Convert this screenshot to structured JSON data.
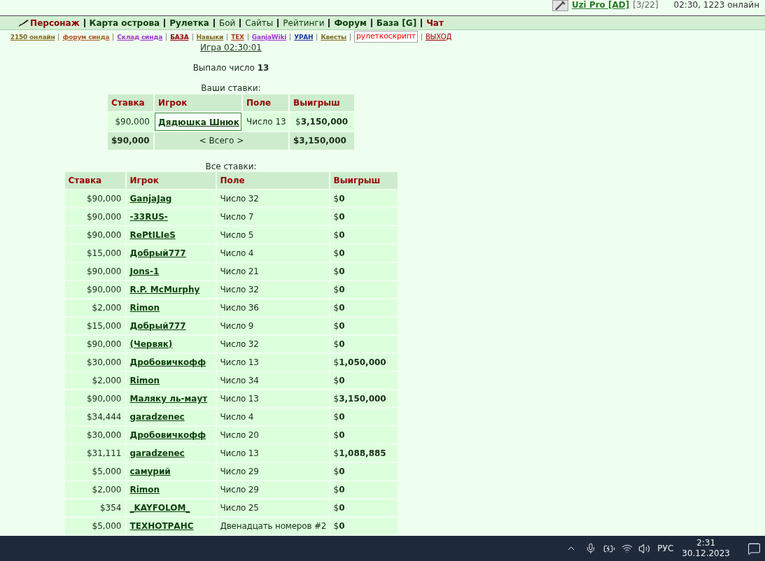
{
  "user_bar": {
    "name": "Uzi Pro [AD]",
    "rank": "[3/22]",
    "status": "02:30, 1223 онлайн"
  },
  "nav": [
    {
      "label": "Персонаж",
      "bold": true,
      "color": "#8b0000"
    },
    {
      "label": "Карта острова",
      "bold": true,
      "color": "#0b3d0b"
    },
    {
      "label": "Рулетка",
      "bold": true,
      "color": "#0b3d0b"
    },
    {
      "label": "Бой",
      "bold": false,
      "color": "#0b3d0b"
    },
    {
      "label": "Сайты",
      "bold": false,
      "color": "#0b3d0b"
    },
    {
      "label": "Рейтинги",
      "bold": false,
      "color": "#0b3d0b"
    },
    {
      "label": "Форум",
      "bold": true,
      "color": "#0b3d0b"
    },
    {
      "label": "База [G]",
      "bold": true,
      "color": "#0b3d0b"
    },
    {
      "label": "Чат",
      "bold": true,
      "color": "#8b0000"
    }
  ],
  "sub_links": [
    {
      "label": "2150 онлайн",
      "kind": "link",
      "color": "#7d6b1e"
    },
    {
      "label": "форум синда",
      "kind": "link",
      "color": "#b05a28"
    },
    {
      "label": "Склад синда",
      "kind": "link",
      "color": "#a030d0"
    },
    {
      "label": "БАЗА",
      "kind": "link",
      "color": "#8b0000"
    },
    {
      "label": "Навыки",
      "kind": "link",
      "color": "#7d6b1e"
    },
    {
      "label": "ТЕХ",
      "kind": "link",
      "color": "#b03a1a"
    },
    {
      "label": "GanjaWiki",
      "kind": "link",
      "color": "#a030d0"
    },
    {
      "label": "УРАН",
      "kind": "link",
      "color": "#1a3aa0"
    },
    {
      "label": "Квесты",
      "kind": "link",
      "color": "#7d6b1e"
    },
    {
      "label": "рулеткоскрипт",
      "kind": "boxed",
      "color": "#ff0000"
    },
    {
      "label": "ВЫХОД",
      "kind": "plain",
      "color": "#a00000"
    }
  ],
  "game_link": "Игра 02:30:01",
  "result": "Выпало число **13**",
  "my_bets": {
    "title": "Ваши ставки:",
    "columns": [
      "Ставка",
      "Игрок",
      "Поле",
      "Выигрыш"
    ],
    "rows": [
      {
        "bet": "$90,000",
        "player": "Дядюшка Шнюк",
        "field": "Число 13",
        "win": "$**3,150,000**",
        "highlighted": true
      }
    ],
    "total": {
      "bet": "$90,000",
      "label": "< Всего >",
      "win": "$3,150,000"
    }
  },
  "all_bets": {
    "title": "Все ставки:",
    "columns": [
      "Ставка",
      "Игрок",
      "Поле",
      "Выигрыш"
    ],
    "rows": [
      {
        "bet": "$90,000",
        "player": "GanjaJag",
        "field": "Число 32",
        "win": "$**0**"
      },
      {
        "bet": "$90,000",
        "player": "-33RUS-",
        "field": "Число 7",
        "win": "$**0**"
      },
      {
        "bet": "$90,000",
        "player": "RePtILIeS",
        "field": "Число 5",
        "win": "$**0**"
      },
      {
        "bet": "$15,000",
        "player": "Добрый777",
        "field": "Число 4",
        "win": "$**0**"
      },
      {
        "bet": "$90,000",
        "player": "Jons-1",
        "field": "Число 21",
        "win": "$**0**"
      },
      {
        "bet": "$90,000",
        "player": "R.P. McMurphy",
        "field": "Число 32",
        "win": "$**0**"
      },
      {
        "bet": "$2,000",
        "player": "Rimon",
        "field": "Число 36",
        "win": "$**0**"
      },
      {
        "bet": "$15,000",
        "player": "Добрый777",
        "field": "Число 9",
        "win": "$**0**"
      },
      {
        "bet": "$90,000",
        "player": "(Червяк)",
        "field": "Число 32",
        "win": "$**0**"
      },
      {
        "bet": "$30,000",
        "player": "Дробовичкофф",
        "field": "Число 13",
        "win": "$**1,050,000**"
      },
      {
        "bet": "$2,000",
        "player": "Rimon",
        "field": "Число 34",
        "win": "$**0**"
      },
      {
        "bet": "$90,000",
        "player": "Маляку ль-маут",
        "field": "Число 13",
        "win": "$**3,150,000**"
      },
      {
        "bet": "$34,444",
        "player": "garadzenec",
        "field": "Число 4",
        "win": "$**0**"
      },
      {
        "bet": "$30,000",
        "player": "Дробовичкофф",
        "field": "Число 20",
        "win": "$**0**"
      },
      {
        "bet": "$31,111",
        "player": "garadzenec",
        "field": "Число 13",
        "win": "$**1,088,885**"
      },
      {
        "bet": "$5,000",
        "player": "самурий",
        "field": "Число 29",
        "win": "$**0**"
      },
      {
        "bet": "$2,000",
        "player": "Rimon",
        "field": "Число 29",
        "win": "$**0**"
      },
      {
        "bet": "$354",
        "player": "_KAYFOLOM_",
        "field": "Число 25",
        "win": "$**0**"
      },
      {
        "bet": "$5,000",
        "player": "ТЕХНОТРАНС",
        "field": "Двенадцать номеров #2",
        "win": "$**0**"
      }
    ]
  },
  "taskbar": {
    "language": "РУС",
    "time": "2:31",
    "date": "30.12.2023"
  }
}
